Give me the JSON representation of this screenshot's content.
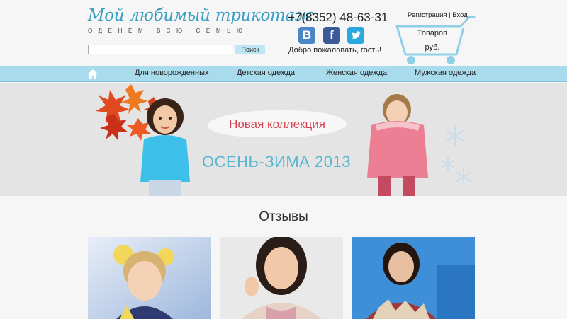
{
  "header": {
    "logo_title": "Мой любимый трикотаж",
    "logo_subtitle": "ОДЕНЕМ ВСЮ СЕМЬЮ",
    "search_value": "",
    "search_button": "Поиск",
    "phone": "+7(8352) 48-63-31",
    "social": {
      "vk": "B",
      "facebook": "f",
      "twitter": "🐦"
    },
    "welcome": "Добро пожаловать, гость!",
    "auth": {
      "register": "Регистрация",
      "separator": "|",
      "login": "Вход"
    },
    "cart": {
      "items_label": "Товаров",
      "sum_label": "руб."
    }
  },
  "nav": {
    "home_icon": "home-icon",
    "items": [
      {
        "label": "Для новорожденных"
      },
      {
        "label": "Детская одежда"
      },
      {
        "label": "Женская одежда"
      },
      {
        "label": "Мужская одежда"
      }
    ]
  },
  "banner": {
    "title": "Новая коллекция",
    "season": "ОСЕНЬ-ЗИМА 2013"
  },
  "reviews": {
    "title": "Отзывы"
  },
  "colors": {
    "brand": "#3a9fc2",
    "nav_bg": "#a8dcec",
    "accent_red": "#d84350",
    "season_blue": "#5ab6cf"
  }
}
